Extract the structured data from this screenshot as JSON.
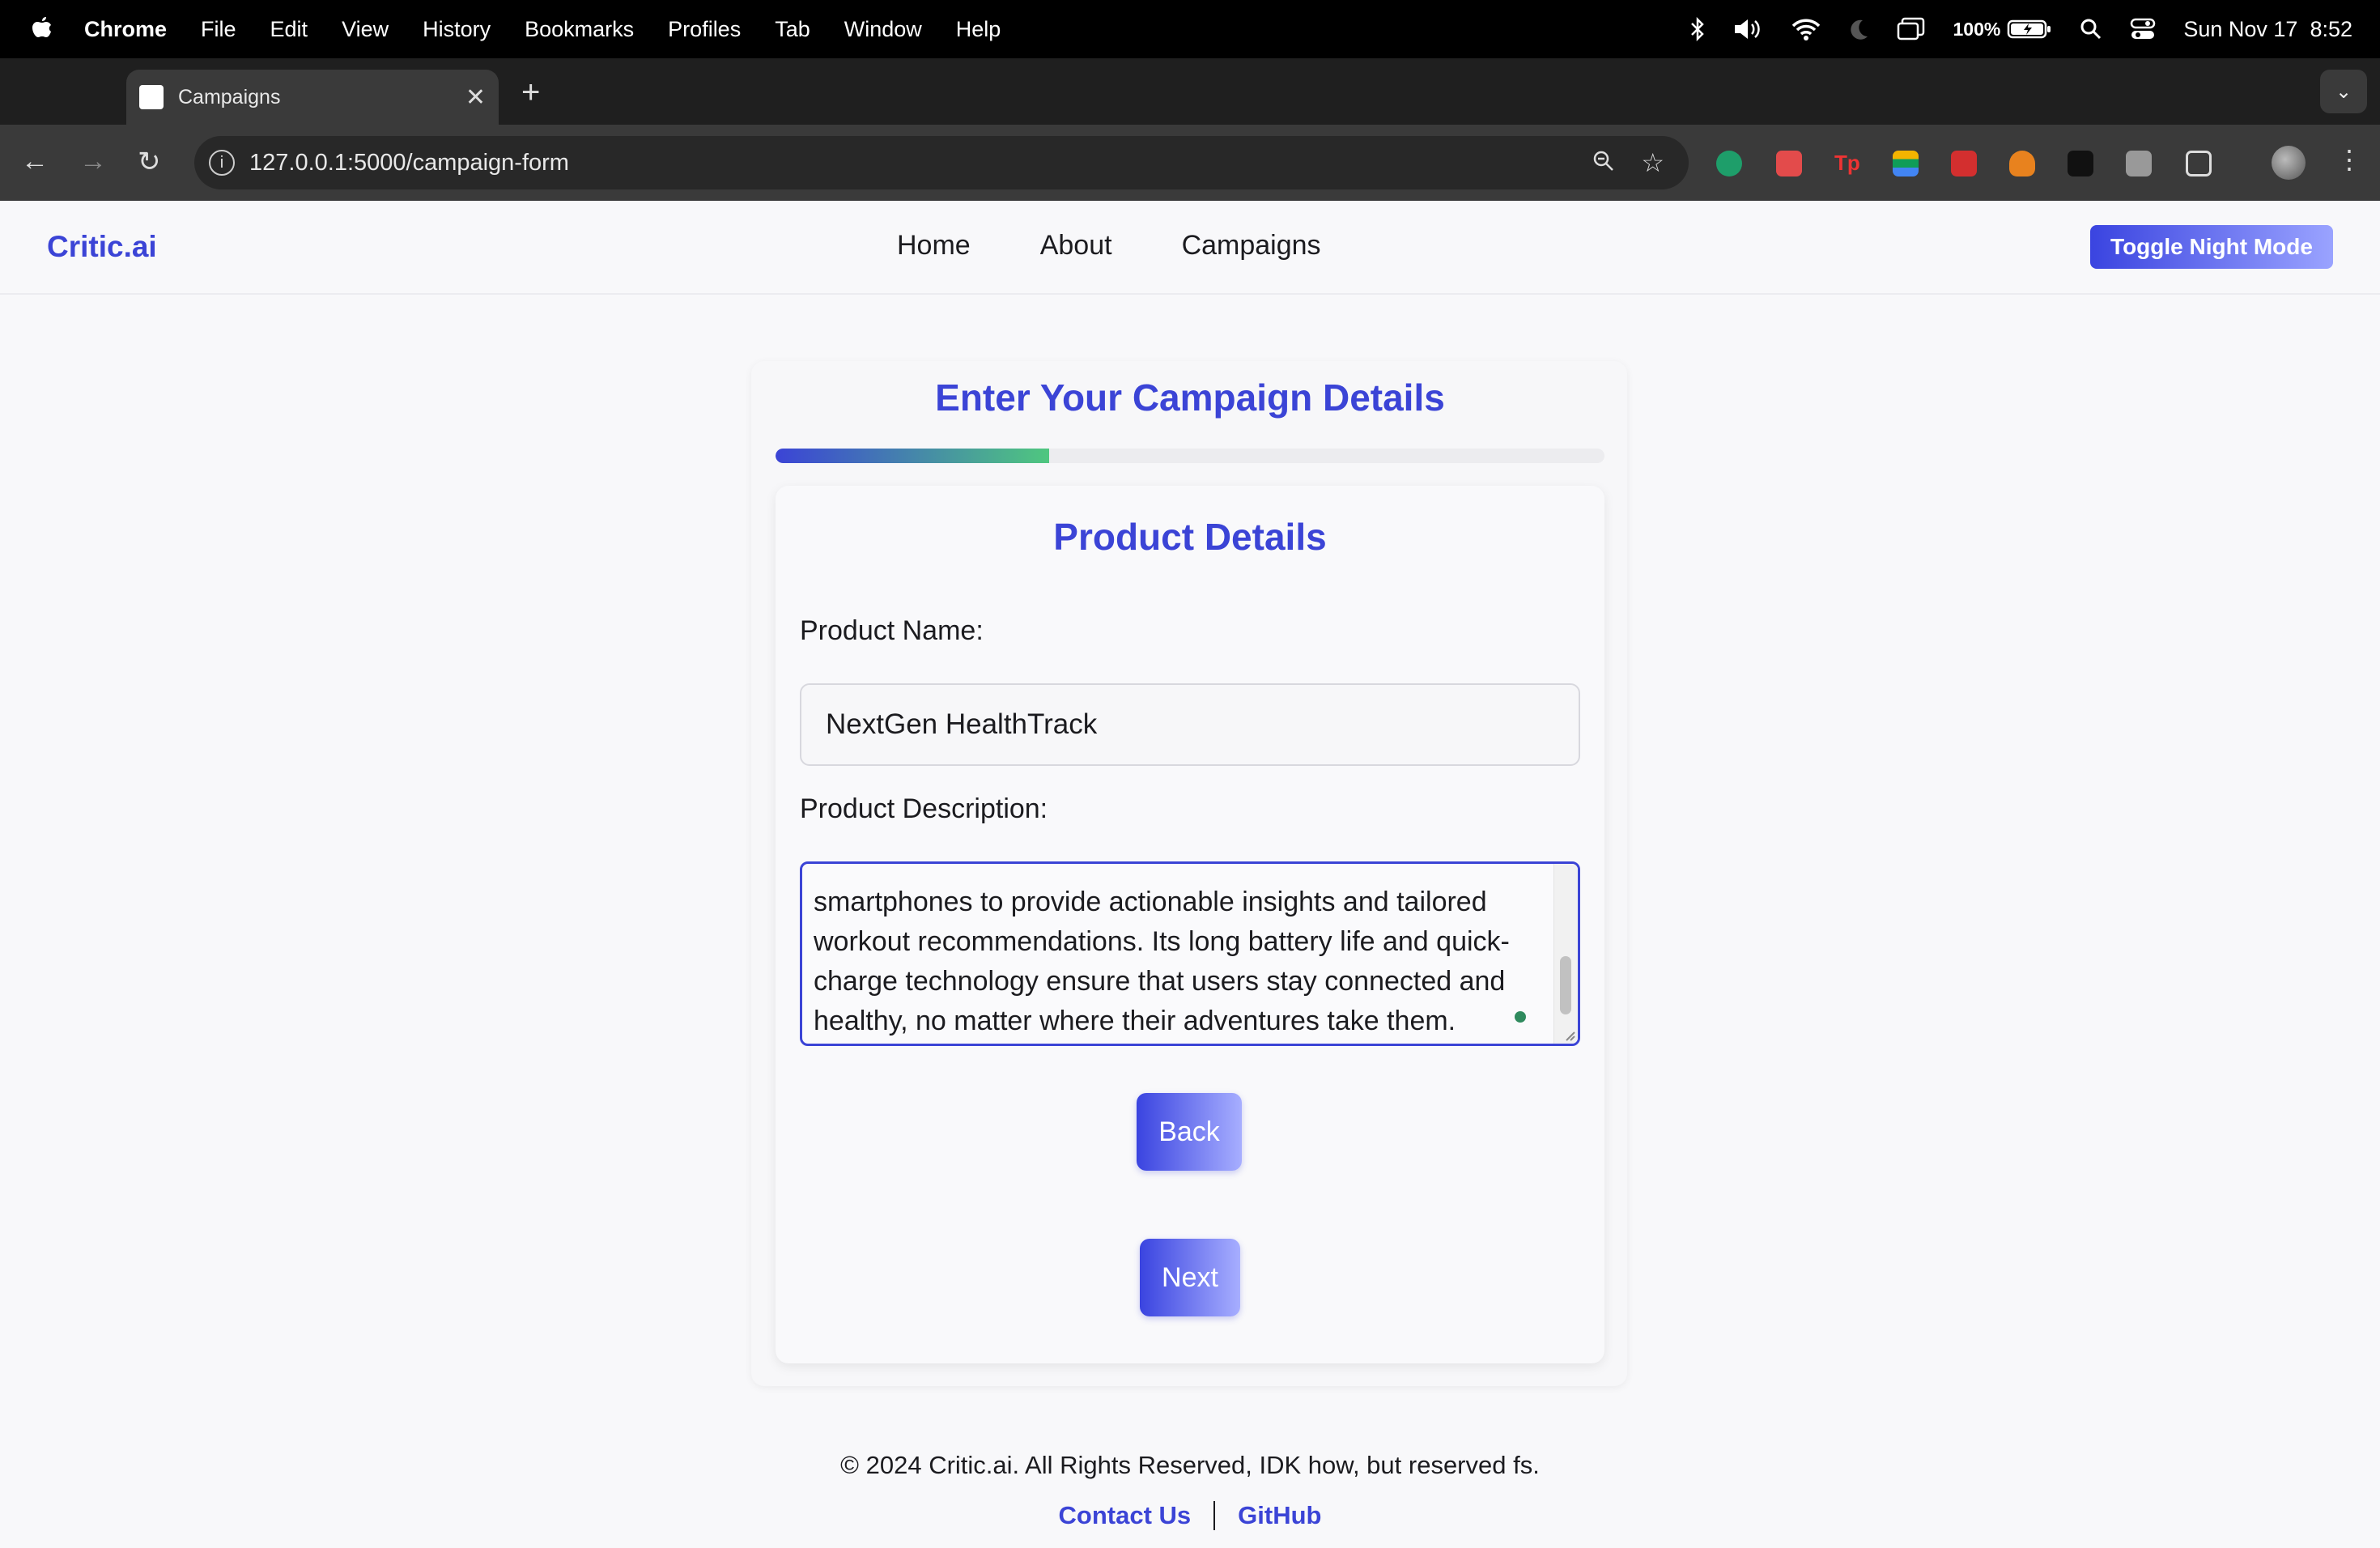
{
  "menubar": {
    "app_name": "Chrome",
    "items": [
      "File",
      "Edit",
      "View",
      "History",
      "Bookmarks",
      "Profiles",
      "Tab",
      "Window",
      "Help"
    ],
    "battery": "100%",
    "datetime": "Sun Nov 17  8:52"
  },
  "browser": {
    "tab_title": "Campaigns",
    "url": "127.0.0.1:5000/campaign-form",
    "extension_icons": [
      "grammarly-icon",
      "red-extension-icon",
      "tp-extension-icon",
      "color-extension-icon",
      "red-play-extension-icon",
      "metamask-fox-icon",
      "dark-extension-icon",
      "gray-extension-icon"
    ],
    "colors": {
      "chrome_dark": "#1f1f1f",
      "toolbar": "#3a3a3a"
    }
  },
  "site": {
    "brand": "Critic.ai",
    "nav": [
      "Home",
      "About",
      "Campaigns"
    ],
    "night_mode_label": "Toggle Night Mode",
    "accent_color": "#3b44d6"
  },
  "form": {
    "title": "Enter Your Campaign Details",
    "progress_fraction": 0.33,
    "section_title": "Product Details",
    "product_name_label": "Product Name:",
    "product_name_value": "NextGen HealthTrack",
    "product_description_label": "Product Description:",
    "product_description_visible_lines": [
      "smartphones to provide actionable insights and tailored",
      "workout recommendations. Its long battery life and quick-",
      "charge technology ensure that users stay connected and",
      "healthy, no matter where their adventures take them."
    ],
    "back_label": "Back",
    "next_label": "Next"
  },
  "footer": {
    "copyright": "© 2024 Critic.ai. All Rights Reserved, IDK how, but reserved fs.",
    "contact_label": "Contact Us",
    "github_label": "GitHub"
  }
}
